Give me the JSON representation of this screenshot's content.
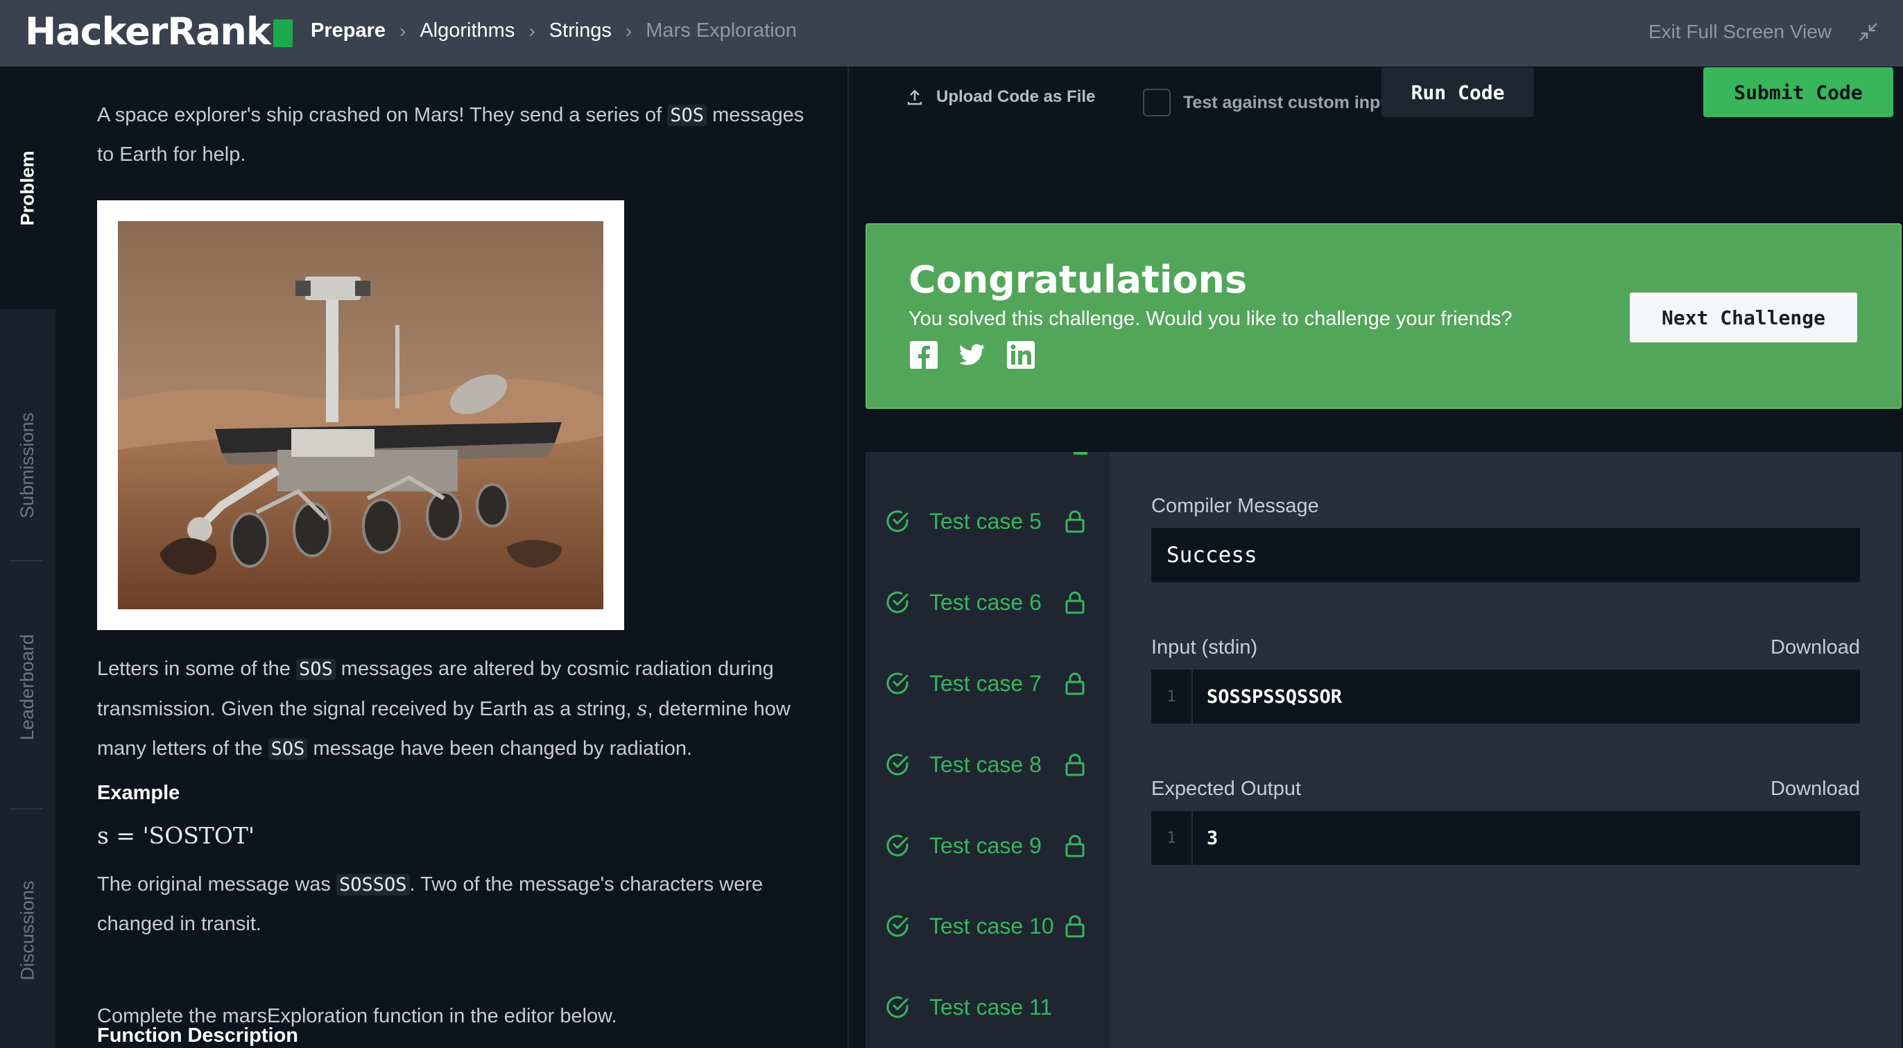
{
  "header": {
    "logo_text": "HackerRank",
    "breadcrumb": [
      "Prepare",
      "Algorithms",
      "Strings",
      "Mars Exploration"
    ],
    "exit_fullscreen": "Exit Full Screen View"
  },
  "side_tabs": [
    "Problem",
    "Submissions",
    "Leaderboard",
    "Discussions"
  ],
  "problem": {
    "intro_a": "A space explorer's ship crashed on Mars! They send a series of ",
    "intro_code": "SOS",
    "intro_b": " messages",
    "intro_c": "to Earth for help.",
    "p2_a": "Letters in some of the ",
    "p2_code": "SOS",
    "p2_b": " messages are altered by cosmic radiation during",
    "p2_line2_a": "transmission. Given the signal received by Earth as a string, ",
    "p2_var": "s",
    "p2_line2_b": ", determine how",
    "p2_line3_a": "many letters of the ",
    "p2_line3_code": "SOS",
    "p2_line3_b": " message have been changed by radiation.",
    "example_heading": "Example",
    "example_math": "s = 'SOSTOT'",
    "p3_a": "The original message was ",
    "p3_code": "SOSSOS",
    "p3_b": ". Two of the message's characters were",
    "p3_line2": "changed in transit.",
    "function_heading": "Function Description",
    "p4": "Complete the marsExploration function in the editor below."
  },
  "toolbar": {
    "upload": "Upload Code as File",
    "custom_input": "Test against custom input",
    "run": "Run Code",
    "submit": "Submit Code"
  },
  "congrats": {
    "title": "Congratulations",
    "subtitle": "You solved this challenge. Would you like to challenge your friends?",
    "next": "Next Challenge",
    "social_icons": [
      "facebook-icon",
      "twitter-icon",
      "linkedin-icon"
    ],
    "bg_color": "#52a65a"
  },
  "test_cases": [
    "Test case 5",
    "Test case 6",
    "Test case 7",
    "Test case 8",
    "Test case 9",
    "Test case 10",
    "Test case 11"
  ],
  "detail": {
    "compiler_label": "Compiler Message",
    "compiler_value": "Success",
    "input_label": "Input (stdin)",
    "input_line_no": "1",
    "input_value": "SOSSPSSQSSOR",
    "expected_label": "Expected Output",
    "expected_line_no": "1",
    "expected_value": "3",
    "download": "Download"
  },
  "colors": {
    "accent_green": "#39b55a",
    "topbar": "#39424e",
    "background": "#0e141e"
  }
}
